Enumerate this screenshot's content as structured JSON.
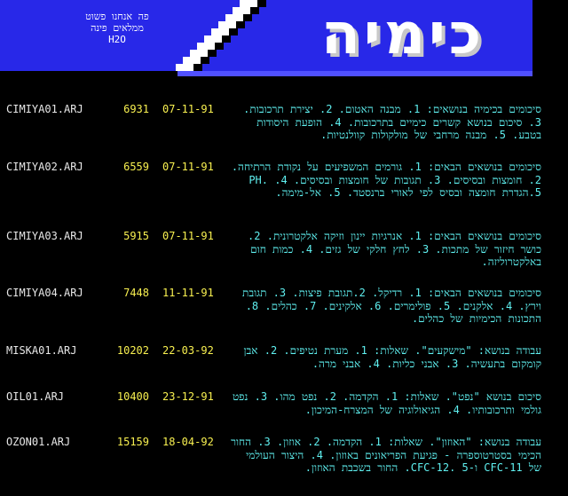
{
  "header": {
    "logo_title": "כימיה",
    "tagline_1": "פה אנחנו פשוט",
    "tagline_2": "ממלאים פינה",
    "tagline_3": "H2O"
  },
  "colors": {
    "background": "#000000",
    "banner_blue": "#2828e8",
    "filename": "#e8e8e8",
    "numbers": "#f8f050",
    "description": "#5ff0f0"
  },
  "files": [
    {
      "name": "CIMIYA01.ARJ",
      "size": "6931",
      "date": "07-11-91",
      "desc": "סיכומים בכימיה בנושאים: 1. מבנה האטום. 2. יצירת תרכובות. 3. סיכום בנושא קשרים כימיים בתרכובות. 4. הופעת היסודות בטבע. 5. מבנה מרחבי של מולקולות קוולנטיות."
    },
    {
      "name": "CIMIYA02.ARJ",
      "size": "6559",
      "date": "07-11-91",
      "desc": "סיכומים בנושאים הבאים: 1. גורמים המשפיעים על נקודת הרתיחה. 2. חומצות ובסיסים. 3. תגובות של חומצות ובסיסים. 4. PH. 5.הגדרת חומצה ובסיס לפי לאורי ברנסטד. 5. אל-מימה."
    },
    {
      "name": "CIMIYA03.ARJ",
      "size": "5915",
      "date": "07-11-91",
      "desc": "סיכומים בנושאים הבאים: 1. אנרגיות יינון וזיקה אלקטרונית. 2. כושר חיזור של מתכות. 3. לחץ חלקי של גזים. 4. כמות חום באלקטרוליזה."
    },
    {
      "name": "CIMIYA04.ARJ",
      "size": "7448",
      "date": "11-11-91",
      "desc": "סיכומים בנושאים הבאים: 1. רדיקל. 2.תגובת פיצות. 3. תגובת וירץ. 4. אלקנים. 5. פולימרים. 6. אלקינים. 7. כהלים. 8. התכונות הכימיות של כהלים."
    },
    {
      "name": "MISKA01.ARJ",
      "size": "10202",
      "date": "22-03-92",
      "desc": "עבודה בנושא: \"מישקעים\". שאלות: 1. מערת נטיפים. 2. אבן קומקום בתעשיה. 3. אבני כליות. 4. אבני מרה."
    },
    {
      "name": "OIL01.ARJ",
      "size": "10400",
      "date": "23-12-91",
      "desc": "סיכום בנושא \"נפט\". שאלות: 1. הקדמה. 2. נפט מהו. 3. נפט גולמי ותרכובותיו. 4. הגיאולוגיה של המצרח-המיכון."
    },
    {
      "name": "OZON01.ARJ",
      "size": "15159",
      "date": "18-04-92",
      "desc": "עבודה בנושא: \"האוזון\". שאלות: 1. הקדמה. 2. אוזון. 3. החור הכימי בסטרטוספרה - פגיעת הפריאונים באוזון. 4. היצור העולמי של CFC-11 ו-CFC-12. 5. החור בשכבת האוזון."
    }
  ]
}
